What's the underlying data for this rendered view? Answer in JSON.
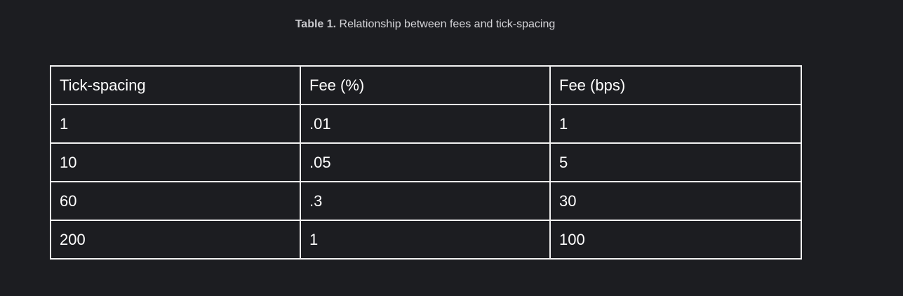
{
  "caption": {
    "label": "Table 1.",
    "text": " Relationship between fees and tick-spacing"
  },
  "table": {
    "headers": [
      "Tick-spacing",
      "Fee (%)",
      "Fee (bps)"
    ],
    "rows": [
      [
        "1",
        ".01",
        "1"
      ],
      [
        "10",
        ".05",
        "5"
      ],
      [
        "60",
        ".3",
        "30"
      ],
      [
        "200",
        "1",
        "100"
      ]
    ]
  }
}
